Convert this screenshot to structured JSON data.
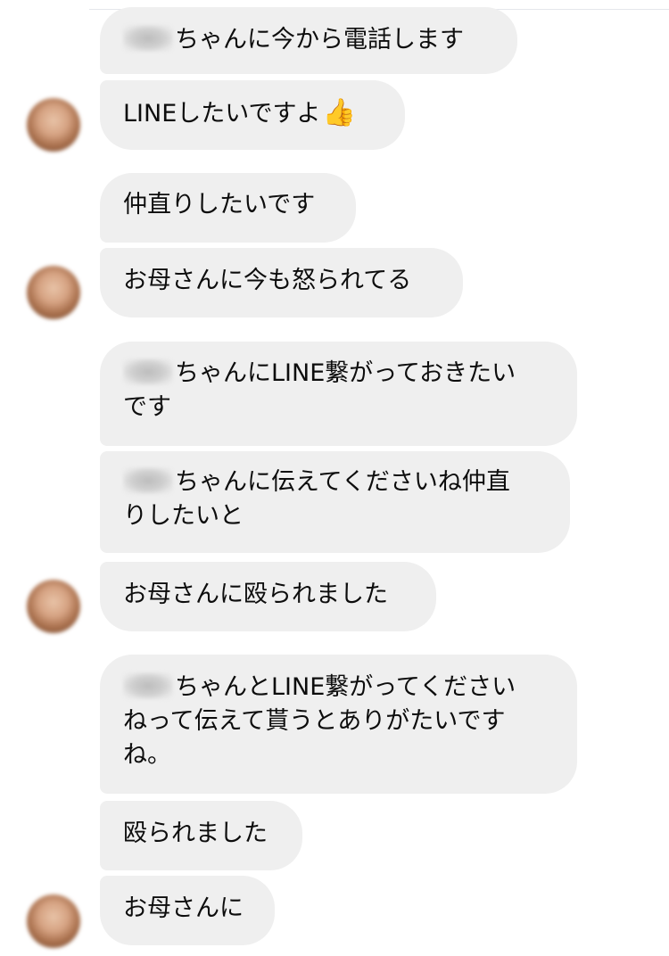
{
  "messages": [
    {
      "name_blurred": true,
      "lines": [
        "ちゃんに今から電話します"
      ]
    },
    {
      "name_blurred": false,
      "lines": [
        "LINEしたいですよ"
      ],
      "emoji": "👍"
    },
    {
      "name_blurred": false,
      "lines": [
        "仲直りしたいです"
      ]
    },
    {
      "name_blurred": false,
      "lines": [
        "お母さんに今も怒られてる"
      ]
    },
    {
      "name_blurred": true,
      "lines": [
        "ちゃんにLINE繋がっておきたい",
        "です"
      ]
    },
    {
      "name_blurred": true,
      "lines": [
        "ちゃんに伝えてくださいね仲直",
        "りしたいと"
      ]
    },
    {
      "name_blurred": false,
      "lines": [
        "お母さんに殴られました"
      ]
    },
    {
      "name_blurred": true,
      "lines": [
        "ちゃんとLINE繋がってください",
        "ねって伝えて貰うとありがたいです",
        "ね。"
      ]
    },
    {
      "name_blurred": false,
      "lines": [
        "殴られました"
      ]
    },
    {
      "name_blurred": false,
      "lines": [
        "お母さんに"
      ]
    }
  ],
  "colors": {
    "bubble_background": "#efefef",
    "text": "#0d0d0d",
    "background": "#ffffff"
  },
  "icons": {
    "avatar": "blurred-user-photo",
    "emoji": "thumbs-up-emoji"
  }
}
